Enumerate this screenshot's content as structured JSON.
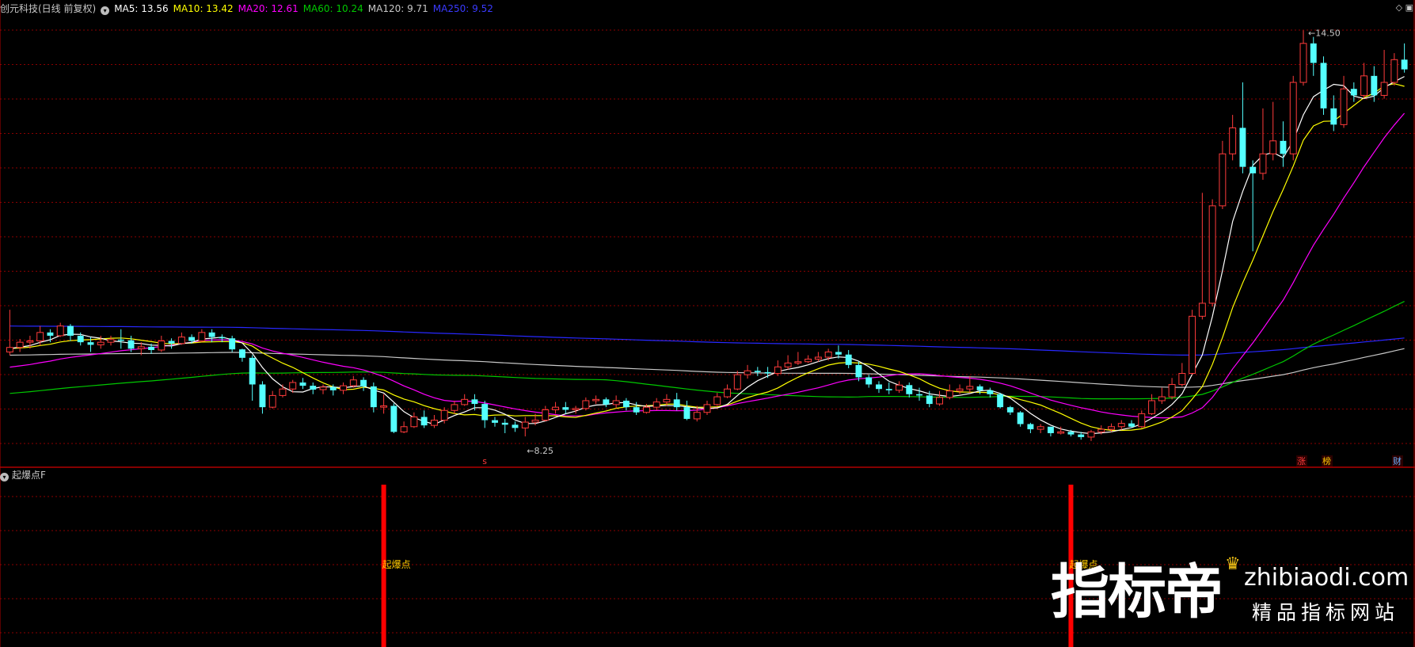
{
  "header": {
    "stock": "创元科技(日线 前复权)",
    "ma5": "MA5: 13.56",
    "ma10": "MA10: 13.42",
    "ma20": "MA20: 12.61",
    "ma60": "MA60: 10.24",
    "ma120": "MA120: 9.71",
    "ma250": "MA250: 9.52"
  },
  "colors": {
    "up": "#ff3b3b",
    "down": "#54ffff",
    "ma5": "#ffffff",
    "ma10": "#ffff00",
    "ma20": "#ff00ff",
    "ma60": "#00c800",
    "ma120": "#c8c8c8",
    "ma250": "#2828ff",
    "grid": "#8b0000",
    "signal": "#ff0000",
    "signal_text": "#ffcc00"
  },
  "annotations": {
    "high_label": "14.50",
    "low_label": "8.25",
    "marker_s": "s",
    "marker_zhang": "涨",
    "marker_bang": "榜",
    "marker_cai": "财"
  },
  "indicator": {
    "title": "起爆点F",
    "signal_label": "起爆点"
  },
  "watermark": {
    "cn": "指标帝",
    "en": "zhibiaodi.com",
    "sub": "精品指标网站"
  },
  "chart_data": {
    "type": "candlestick",
    "ylim": [
      7.8,
      14.7
    ],
    "high": 14.5,
    "low": 8.25,
    "candles": [
      [
        9.55,
        9.62,
        9.5,
        10.2
      ],
      [
        9.62,
        9.7,
        9.55,
        9.75
      ],
      [
        9.7,
        9.72,
        9.6,
        9.8
      ],
      [
        9.72,
        9.85,
        9.65,
        9.95
      ],
      [
        9.85,
        9.8,
        9.7,
        9.9
      ],
      [
        9.8,
        9.95,
        9.78,
        10.0
      ],
      [
        9.95,
        9.8,
        9.72,
        9.98
      ],
      [
        9.8,
        9.7,
        9.65,
        9.85
      ],
      [
        9.7,
        9.66,
        9.55,
        9.78
      ],
      [
        9.66,
        9.7,
        9.6,
        9.8
      ],
      [
        9.7,
        9.74,
        9.65,
        9.8
      ],
      [
        9.74,
        9.73,
        9.6,
        9.9
      ],
      [
        9.73,
        9.6,
        9.55,
        9.8
      ],
      [
        9.6,
        9.63,
        9.5,
        9.7
      ],
      [
        9.63,
        9.58,
        9.52,
        9.68
      ],
      [
        9.58,
        9.72,
        9.55,
        9.8
      ],
      [
        9.72,
        9.68,
        9.6,
        9.76
      ],
      [
        9.68,
        9.78,
        9.66,
        9.85
      ],
      [
        9.78,
        9.72,
        9.68,
        9.82
      ],
      [
        9.72,
        9.85,
        9.7,
        9.9
      ],
      [
        9.85,
        9.78,
        9.7,
        9.9
      ],
      [
        9.78,
        9.76,
        9.7,
        9.82
      ],
      [
        9.76,
        9.59,
        9.55,
        9.8
      ],
      [
        9.59,
        9.46,
        9.4,
        9.6
      ],
      [
        9.46,
        9.05,
        8.8,
        9.5
      ],
      [
        9.05,
        8.7,
        8.6,
        9.1
      ],
      [
        8.7,
        8.88,
        8.68,
        8.95
      ],
      [
        8.88,
        8.98,
        8.85,
        9.05
      ],
      [
        8.98,
        9.08,
        8.92,
        9.12
      ],
      [
        9.08,
        9.03,
        8.98,
        9.15
      ],
      [
        9.03,
        8.97,
        8.9,
        9.08
      ],
      [
        8.97,
        9.01,
        8.9,
        9.05
      ],
      [
        9.01,
        8.96,
        8.88,
        9.05
      ],
      [
        8.96,
        9.03,
        8.9,
        9.08
      ],
      [
        9.03,
        9.12,
        9.0,
        9.18
      ],
      [
        9.12,
        9.02,
        8.95,
        9.16
      ],
      [
        9.02,
        8.7,
        8.62,
        9.08
      ],
      [
        8.7,
        8.72,
        8.6,
        8.9
      ],
      [
        8.72,
        8.32,
        8.3,
        8.76
      ],
      [
        8.32,
        8.4,
        8.3,
        8.48
      ],
      [
        8.4,
        8.55,
        8.38,
        8.62
      ],
      [
        8.55,
        8.42,
        8.38,
        8.65
      ],
      [
        8.42,
        8.5,
        8.38,
        8.58
      ],
      [
        8.5,
        8.65,
        8.45,
        8.7
      ],
      [
        8.65,
        8.74,
        8.6,
        8.8
      ],
      [
        8.74,
        8.82,
        8.72,
        8.9
      ],
      [
        8.82,
        8.75,
        8.65,
        8.9
      ],
      [
        8.75,
        8.5,
        8.38,
        8.8
      ],
      [
        8.5,
        8.46,
        8.4,
        8.55
      ],
      [
        8.46,
        8.43,
        8.3,
        8.52
      ],
      [
        8.43,
        8.38,
        8.32,
        8.48
      ],
      [
        8.38,
        8.47,
        8.25,
        8.55
      ],
      [
        8.47,
        8.5,
        8.42,
        8.6
      ],
      [
        8.5,
        8.66,
        8.48,
        8.72
      ],
      [
        8.66,
        8.7,
        8.6,
        8.78
      ],
      [
        8.7,
        8.66,
        8.6,
        8.78
      ],
      [
        8.66,
        8.68,
        8.6,
        8.72
      ],
      [
        8.68,
        8.8,
        8.65,
        8.85
      ],
      [
        8.8,
        8.82,
        8.75,
        8.88
      ],
      [
        8.82,
        8.74,
        8.7,
        8.85
      ],
      [
        8.74,
        8.8,
        8.68,
        8.88
      ],
      [
        8.8,
        8.7,
        8.65,
        8.84
      ],
      [
        8.7,
        8.62,
        8.58,
        8.78
      ],
      [
        8.62,
        8.7,
        8.6,
        8.75
      ],
      [
        8.7,
        8.78,
        8.65,
        8.84
      ],
      [
        8.78,
        8.82,
        8.72,
        8.9
      ],
      [
        8.82,
        8.7,
        8.65,
        8.92
      ],
      [
        8.7,
        8.52,
        8.5,
        8.8
      ],
      [
        8.52,
        8.62,
        8.48,
        8.72
      ],
      [
        8.62,
        8.74,
        8.58,
        8.8
      ],
      [
        8.74,
        8.86,
        8.72,
        8.92
      ],
      [
        8.86,
        8.98,
        8.84,
        9.05
      ],
      [
        8.98,
        9.2,
        8.96,
        9.26
      ],
      [
        9.2,
        9.26,
        9.14,
        9.35
      ],
      [
        9.26,
        9.24,
        9.18,
        9.32
      ],
      [
        9.24,
        9.22,
        9.15,
        9.32
      ],
      [
        9.22,
        9.32,
        9.18,
        9.42
      ],
      [
        9.32,
        9.38,
        9.28,
        9.5
      ],
      [
        9.38,
        9.4,
        9.35,
        9.55
      ],
      [
        9.4,
        9.44,
        9.38,
        9.5
      ],
      [
        9.44,
        9.47,
        9.4,
        9.55
      ],
      [
        9.47,
        9.55,
        9.42,
        9.6
      ],
      [
        9.55,
        9.51,
        9.45,
        9.65
      ],
      [
        9.51,
        9.35,
        9.3,
        9.58
      ],
      [
        9.35,
        9.16,
        9.1,
        9.4
      ],
      [
        9.16,
        9.05,
        9.0,
        9.2
      ],
      [
        9.05,
        8.98,
        8.92,
        9.1
      ],
      [
        8.98,
        8.96,
        8.9,
        9.08
      ],
      [
        8.96,
        9.04,
        8.92,
        9.1
      ],
      [
        9.04,
        8.9,
        8.85,
        9.08
      ],
      [
        8.9,
        8.88,
        8.8,
        9.0
      ],
      [
        8.88,
        8.75,
        8.7,
        8.95
      ],
      [
        8.75,
        8.85,
        8.72,
        8.95
      ],
      [
        8.85,
        8.95,
        8.82,
        9.05
      ],
      [
        8.95,
        8.98,
        8.9,
        9.05
      ],
      [
        8.98,
        9.02,
        8.92,
        9.18
      ],
      [
        9.02,
        8.96,
        8.9,
        9.05
      ],
      [
        8.96,
        8.9,
        8.85,
        9.0
      ],
      [
        8.9,
        8.7,
        8.68,
        8.92
      ],
      [
        8.7,
        8.62,
        8.58,
        8.72
      ],
      [
        8.62,
        8.44,
        8.4,
        8.64
      ],
      [
        8.44,
        8.36,
        8.3,
        8.46
      ],
      [
        8.36,
        8.4,
        8.3,
        8.44
      ],
      [
        8.4,
        8.3,
        8.25,
        8.4
      ],
      [
        8.3,
        8.32,
        8.28,
        8.4
      ],
      [
        8.32,
        8.28,
        8.25,
        8.35
      ],
      [
        8.28,
        8.24,
        8.2,
        8.32
      ],
      [
        8.24,
        8.32,
        8.18,
        8.35
      ],
      [
        8.32,
        8.36,
        8.28,
        8.42
      ],
      [
        8.36,
        8.4,
        8.32,
        8.45
      ],
      [
        8.4,
        8.45,
        8.35,
        8.5
      ],
      [
        8.45,
        8.4,
        8.38,
        8.5
      ],
      [
        8.4,
        8.6,
        8.38,
        8.65
      ],
      [
        8.6,
        8.8,
        8.58,
        8.9
      ],
      [
        8.8,
        8.86,
        8.75,
        9.0
      ],
      [
        8.86,
        9.05,
        8.82,
        9.15
      ],
      [
        9.05,
        9.22,
        9.02,
        9.38
      ],
      [
        9.22,
        10.1,
        9.2,
        10.2
      ],
      [
        10.1,
        10.3,
        10.05,
        12.0
      ],
      [
        10.3,
        11.8,
        10.25,
        11.9
      ],
      [
        11.8,
        12.6,
        11.75,
        12.8
      ],
      [
        12.6,
        13.0,
        12.5,
        13.2
      ],
      [
        13.0,
        12.4,
        12.3,
        13.7
      ],
      [
        12.4,
        12.3,
        11.1,
        12.5
      ],
      [
        12.3,
        12.6,
        12.2,
        13.3
      ],
      [
        12.6,
        12.8,
        12.5,
        13.4
      ],
      [
        12.8,
        12.6,
        12.4,
        13.1
      ],
      [
        12.6,
        13.7,
        12.5,
        13.8
      ],
      [
        13.7,
        14.3,
        13.65,
        14.5
      ],
      [
        14.3,
        14.0,
        13.8,
        14.4
      ],
      [
        14.0,
        13.3,
        13.2,
        14.1
      ],
      [
        13.3,
        13.05,
        12.95,
        13.5
      ],
      [
        13.05,
        13.6,
        13.0,
        13.8
      ],
      [
        13.6,
        13.5,
        13.4,
        13.7
      ],
      [
        13.5,
        13.8,
        13.45,
        14.0
      ],
      [
        13.8,
        13.5,
        13.4,
        13.95
      ],
      [
        13.5,
        13.7,
        13.45,
        14.2
      ],
      [
        13.7,
        14.05,
        13.65,
        14.15
      ],
      [
        14.05,
        13.9,
        13.85,
        14.3
      ]
    ],
    "ma_values": {
      "ma5": 13.56,
      "ma10": 13.42,
      "ma20": 12.61,
      "ma60": 10.24,
      "ma120": 9.71,
      "ma250": 9.52
    },
    "signals": [
      {
        "candle_index": 37,
        "label": "起爆点"
      },
      {
        "candle_index": 105,
        "label": "起爆点"
      }
    ]
  }
}
